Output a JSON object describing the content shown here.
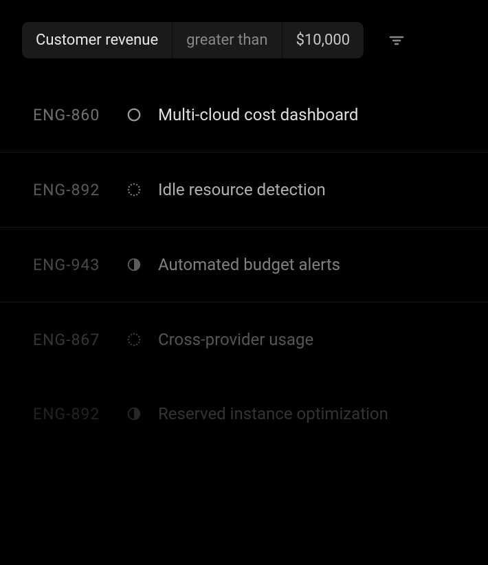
{
  "filter": {
    "field": "Customer revenue",
    "operator": "greater than",
    "value": "$10,000"
  },
  "issues": [
    {
      "id": "ENG-860",
      "title": "Multi-cloud cost dashboard",
      "status": "todo",
      "fade": 0
    },
    {
      "id": "ENG-892",
      "title": "Idle resource detection",
      "status": "backlog",
      "fade": 1
    },
    {
      "id": "ENG-943",
      "title": "Automated budget alerts",
      "status": "inprogress",
      "fade": 2
    },
    {
      "id": "ENG-867",
      "title": "Cross-provider usage",
      "status": "backlog",
      "fade": 3
    },
    {
      "id": "ENG-892",
      "title": "Reserved instance optimization",
      "status": "inprogress",
      "fade": 4
    }
  ]
}
